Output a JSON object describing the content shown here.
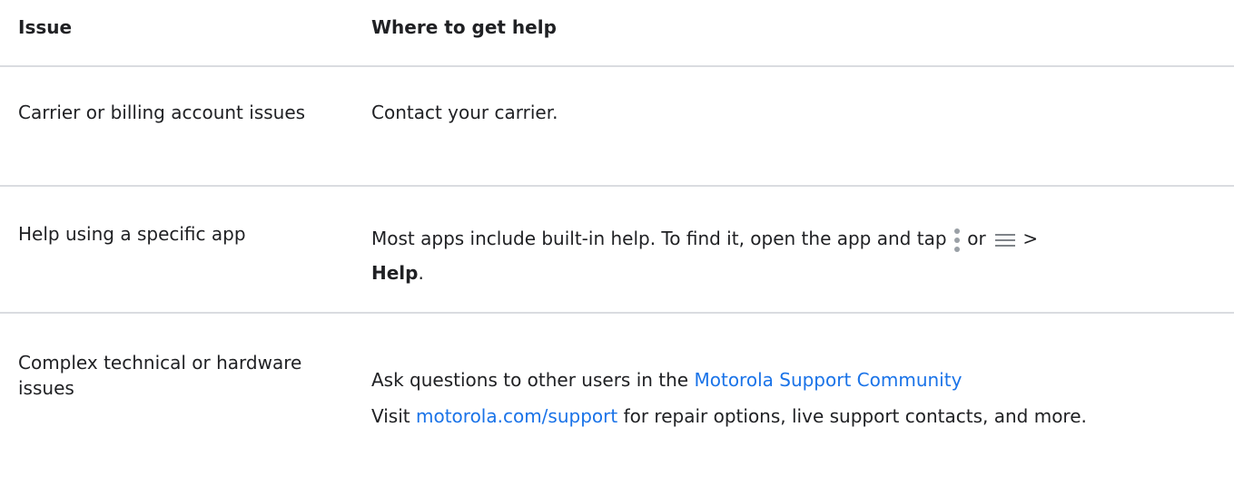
{
  "header": {
    "col1": "Issue",
    "col2": "Where to get help"
  },
  "rows": [
    {
      "issue": "Carrier or billing account issues",
      "help": "Contact your carrier."
    },
    {
      "issue": "Help using a specific app",
      "help_pre": "Most apps include built-in help. To find it, open the app and tap",
      "help_or": "or",
      "help_gt": ">",
      "help_bold": "Help",
      "help_end": "."
    },
    {
      "issue": "Complex technical or hardware issues",
      "help1_pre": "Ask questions to other users in the",
      "help1_link": "Motorola Support Community",
      "help2_pre": "Visit",
      "help2_link": "motorola.com/support",
      "help2_post": "for repair options, live support contacts, and more."
    }
  ],
  "icons": {
    "more_menu": "more-vert-icon",
    "hamburger_menu": "menu-icon"
  },
  "colors": {
    "link": "#1a73e8",
    "divider": "#dadce0",
    "text": "#202124",
    "icon": "#9aa0a6"
  }
}
